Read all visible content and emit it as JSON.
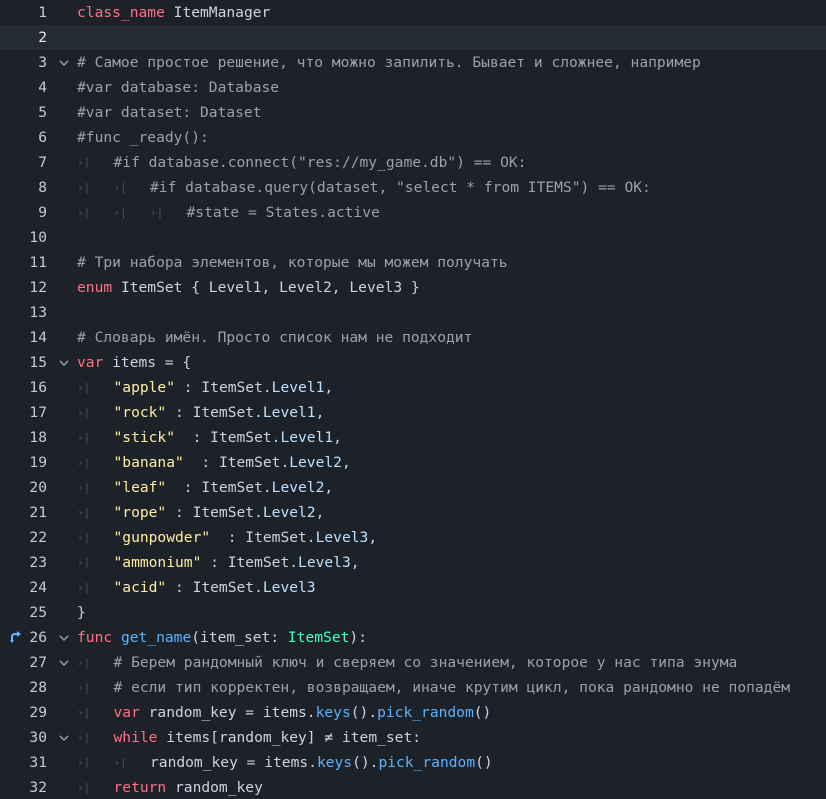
{
  "editor": {
    "theme_colors": {
      "background": "#1d2229",
      "current_line": "#262c35",
      "keyword": "#ff7085",
      "comment": "#9aa1ad",
      "string": "#ffeda1",
      "type": "#42ffc2",
      "function": "#57b3ff",
      "member": "#bce0ff",
      "text": "#cdd3dc",
      "line_number": "#c7cbd1"
    },
    "gutter_icons": {
      "fold_icon": "chevron-down-icon",
      "override_icon": "method-override-arrow-icon",
      "tab_icon": "tab-indent-icon"
    },
    "lines": [
      {
        "n": "1",
        "tabs": 0,
        "tokens": [
          {
            "t": "class_name",
            "c": "kw"
          },
          {
            "t": " ItemManager",
            "c": "txt"
          }
        ]
      },
      {
        "n": "2",
        "tabs": 0,
        "current": true,
        "tokens": []
      },
      {
        "n": "3",
        "tabs": 0,
        "fold": true,
        "tokens": [
          {
            "t": "# Самое простое решение, что можно запилить. Бывает и сложнее, например",
            "c": "cm"
          }
        ]
      },
      {
        "n": "4",
        "tabs": 0,
        "tokens": [
          {
            "t": "#var database: Database",
            "c": "cm"
          }
        ]
      },
      {
        "n": "5",
        "tabs": 0,
        "tokens": [
          {
            "t": "#var dataset: Dataset",
            "c": "cm"
          }
        ]
      },
      {
        "n": "6",
        "tabs": 0,
        "tokens": [
          {
            "t": "#func _ready():",
            "c": "cm"
          }
        ]
      },
      {
        "n": "7",
        "tabs": 1,
        "tokens": [
          {
            "t": "#if database.connect(\"res://my_game.db\") == OK:",
            "c": "cm"
          }
        ]
      },
      {
        "n": "8",
        "tabs": 2,
        "tokens": [
          {
            "t": "#if database.query(dataset, \"select * from ITEMS\") == OK:",
            "c": "cm"
          }
        ]
      },
      {
        "n": "9",
        "tabs": 3,
        "tokens": [
          {
            "t": "#state = States.active",
            "c": "cm"
          }
        ]
      },
      {
        "n": "10",
        "tabs": 0,
        "tokens": []
      },
      {
        "n": "11",
        "tabs": 0,
        "tokens": [
          {
            "t": "# Три набора элементов, которые мы можем получать",
            "c": "cm"
          }
        ]
      },
      {
        "n": "12",
        "tabs": 0,
        "tokens": [
          {
            "t": "enum",
            "c": "kw"
          },
          {
            "t": " ItemSet { Level1, Level2, Level3 }",
            "c": "txt"
          }
        ]
      },
      {
        "n": "13",
        "tabs": 0,
        "tokens": []
      },
      {
        "n": "14",
        "tabs": 0,
        "tokens": [
          {
            "t": "# Словарь имён. Просто список нам не подходит",
            "c": "cm"
          }
        ]
      },
      {
        "n": "15",
        "tabs": 0,
        "fold": true,
        "tokens": [
          {
            "t": "var",
            "c": "kw"
          },
          {
            "t": " items = {",
            "c": "txt"
          }
        ]
      },
      {
        "n": "16",
        "tabs": 1,
        "tokens": [
          {
            "t": "\"apple\"",
            "c": "str"
          },
          {
            "t": " : ItemSet.",
            "c": "txt"
          },
          {
            "t": "Level1",
            "c": "mem"
          },
          {
            "t": ",",
            "c": "txt"
          }
        ]
      },
      {
        "n": "17",
        "tabs": 1,
        "tokens": [
          {
            "t": "\"rock\"",
            "c": "str"
          },
          {
            "t": " : ItemSet.",
            "c": "txt"
          },
          {
            "t": "Level1",
            "c": "mem"
          },
          {
            "t": ",",
            "c": "txt"
          }
        ]
      },
      {
        "n": "18",
        "tabs": 1,
        "tokens": [
          {
            "t": "\"stick\"",
            "c": "str"
          },
          {
            "t": "  : ItemSet.",
            "c": "txt"
          },
          {
            "t": "Level1",
            "c": "mem"
          },
          {
            "t": ",",
            "c": "txt"
          }
        ]
      },
      {
        "n": "19",
        "tabs": 1,
        "tokens": [
          {
            "t": "\"banana\"",
            "c": "str"
          },
          {
            "t": "  : ItemSet.",
            "c": "txt"
          },
          {
            "t": "Level2",
            "c": "mem"
          },
          {
            "t": ",",
            "c": "txt"
          }
        ]
      },
      {
        "n": "20",
        "tabs": 1,
        "tokens": [
          {
            "t": "\"leaf\"",
            "c": "str"
          },
          {
            "t": "  : ItemSet.",
            "c": "txt"
          },
          {
            "t": "Level2",
            "c": "mem"
          },
          {
            "t": ",",
            "c": "txt"
          }
        ]
      },
      {
        "n": "21",
        "tabs": 1,
        "tokens": [
          {
            "t": "\"rope\"",
            "c": "str"
          },
          {
            "t": " : ItemSet.",
            "c": "txt"
          },
          {
            "t": "Level2",
            "c": "mem"
          },
          {
            "t": ",",
            "c": "txt"
          }
        ]
      },
      {
        "n": "22",
        "tabs": 1,
        "tokens": [
          {
            "t": "\"gunpowder\"",
            "c": "str"
          },
          {
            "t": "  : ItemSet.",
            "c": "txt"
          },
          {
            "t": "Level3",
            "c": "mem"
          },
          {
            "t": ",",
            "c": "txt"
          }
        ]
      },
      {
        "n": "23",
        "tabs": 1,
        "tokens": [
          {
            "t": "\"ammonium\"",
            "c": "str"
          },
          {
            "t": " : ItemSet.",
            "c": "txt"
          },
          {
            "t": "Level3",
            "c": "mem"
          },
          {
            "t": ",",
            "c": "txt"
          }
        ]
      },
      {
        "n": "24",
        "tabs": 1,
        "tokens": [
          {
            "t": "\"acid\"",
            "c": "str"
          },
          {
            "t": " : ItemSet.",
            "c": "txt"
          },
          {
            "t": "Level3",
            "c": "mem"
          }
        ]
      },
      {
        "n": "25",
        "tabs": 0,
        "tokens": [
          {
            "t": "}",
            "c": "txt"
          }
        ]
      },
      {
        "n": "26",
        "tabs": 0,
        "fold": true,
        "override": true,
        "tokens": [
          {
            "t": "func",
            "c": "kw"
          },
          {
            "t": " ",
            "c": "txt"
          },
          {
            "t": "get_name",
            "c": "fn"
          },
          {
            "t": "(item_set: ",
            "c": "txt"
          },
          {
            "t": "ItemSet",
            "c": "typ"
          },
          {
            "t": "):",
            "c": "txt"
          }
        ]
      },
      {
        "n": "27",
        "tabs": 1,
        "fold": true,
        "tokens": [
          {
            "t": "# Берем рандомный ключ и сверяем со значением, которое у нас типа энума",
            "c": "cm"
          }
        ]
      },
      {
        "n": "28",
        "tabs": 1,
        "tokens": [
          {
            "t": "# если тип корректен, возвращаем, иначе крутим цикл, пока рандомно не попадём",
            "c": "cm"
          }
        ]
      },
      {
        "n": "29",
        "tabs": 1,
        "tokens": [
          {
            "t": "var",
            "c": "kw"
          },
          {
            "t": " random_key = items.",
            "c": "txt"
          },
          {
            "t": "keys",
            "c": "fn"
          },
          {
            "t": "().",
            "c": "txt"
          },
          {
            "t": "pick_random",
            "c": "fn"
          },
          {
            "t": "()",
            "c": "txt"
          }
        ]
      },
      {
        "n": "30",
        "tabs": 1,
        "fold": true,
        "tokens": [
          {
            "t": "while",
            "c": "kw"
          },
          {
            "t": " items[random_key] ",
            "c": "txt"
          },
          {
            "t": "≠",
            "c": "txt"
          },
          {
            "t": " item_set:",
            "c": "txt"
          }
        ]
      },
      {
        "n": "31",
        "tabs": 2,
        "tokens": [
          {
            "t": "random_key = items.",
            "c": "txt"
          },
          {
            "t": "keys",
            "c": "fn"
          },
          {
            "t": "().",
            "c": "txt"
          },
          {
            "t": "pick_random",
            "c": "fn"
          },
          {
            "t": "()",
            "c": "txt"
          }
        ]
      },
      {
        "n": "32",
        "tabs": 1,
        "tokens": [
          {
            "t": "return",
            "c": "kw"
          },
          {
            "t": " random_key",
            "c": "txt"
          }
        ]
      }
    ]
  }
}
